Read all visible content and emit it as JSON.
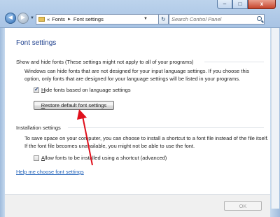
{
  "window": {
    "minimize_glyph": "–",
    "maximize_glyph": "□",
    "close_glyph": "x"
  },
  "nav": {
    "back_glyph": "◄",
    "forward_glyph": "►",
    "dropdown_glyph": "▼"
  },
  "address": {
    "overflow": "«",
    "crumbs": [
      "Fonts",
      "Font settings"
    ],
    "separator": "►",
    "dropdown_glyph": "▼",
    "refresh_glyph": "↻"
  },
  "search": {
    "placeholder": "Search Control Panel",
    "icon": "search-icon"
  },
  "page": {
    "title": "Font settings",
    "show_hide_heading": "Show and hide fonts (These settings might not apply to all of your programs)",
    "show_hide_desc": "Windows can hide fonts that are not designed for your input language settings. If you choose this option, only fonts that are designed for your language settings will be listed in your programs.",
    "hide_fonts_checkbox": {
      "label_access": "H",
      "label_rest": "ide fonts based on language settings",
      "checked": true
    },
    "restore_button": {
      "label_access": "R",
      "label_rest": "estore default font settings"
    },
    "install_heading": "Installation settings",
    "install_desc": "To save space on your computer, you can choose to install a shortcut to a font file instead of the file itself. If the font file becomes unavailable, you might not be able to use the font.",
    "shortcut_checkbox": {
      "label_access": "A",
      "label_rest": "llow fonts to be installed using a shortcut (advanced)",
      "checked": false
    },
    "help_link": "Help me choose font settings"
  },
  "footer": {
    "ok_label": "OK",
    "ok_enabled": false
  },
  "colors": {
    "title_blue": "#1c3e8c",
    "link_blue": "#1d5fb8",
    "arrow_red": "#e0101c"
  }
}
